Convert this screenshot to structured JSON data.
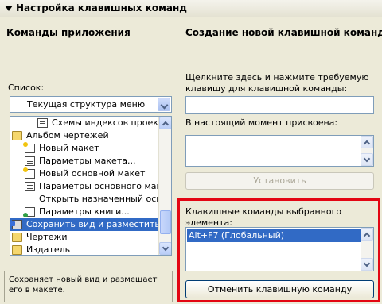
{
  "header": {
    "title": "Настройка клавишных команд"
  },
  "left": {
    "title": "Команды приложения",
    "list_label": "Список:",
    "combo_value": "Текущая структура меню",
    "items": [
      {
        "label": "Схемы индексов проекта... (",
        "icon": "doc-icon",
        "indent": 2
      },
      {
        "label": "Альбом чертежей",
        "icon": "folder-icon",
        "indent": 0
      },
      {
        "label": "Новый макет",
        "icon": "new-layout-icon",
        "indent": 1
      },
      {
        "label": "Параметры макета...",
        "icon": "doc-icon",
        "indent": 1
      },
      {
        "label": "Новый основной макет",
        "icon": "new-layout-icon",
        "indent": 1
      },
      {
        "label": "Параметры основного макета",
        "icon": "doc-icon",
        "indent": 1
      },
      {
        "label": "Открыть назначенный основ",
        "icon": "",
        "indent": 1
      },
      {
        "label": "Параметры книги...",
        "icon": "book-icon",
        "indent": 1
      },
      {
        "label": "Сохранить вид и разместить в ма",
        "icon": "place-view-icon",
        "indent": 0,
        "selected": true
      },
      {
        "label": "Чертежи",
        "icon": "folder-icon",
        "indent": 0
      },
      {
        "label": "Издатель",
        "icon": "folder-icon",
        "indent": 0
      }
    ],
    "description": "Сохраняет новый вид и размещает его в макете."
  },
  "right": {
    "title": "Создание новой клавишной команды:",
    "prompt": "Щелкните здесь и нажмите требуемую клавишу для клавишной команды:",
    "assigned_label": "В настоящий момент присвоена:",
    "set_button": "Установить",
    "selected_shortcuts_label": "Клавишные команды выбранного элемента:",
    "shortcuts": [
      "Alt+F7 (Глобальный)"
    ],
    "remove_button": "Отменить клавишную команду"
  }
}
